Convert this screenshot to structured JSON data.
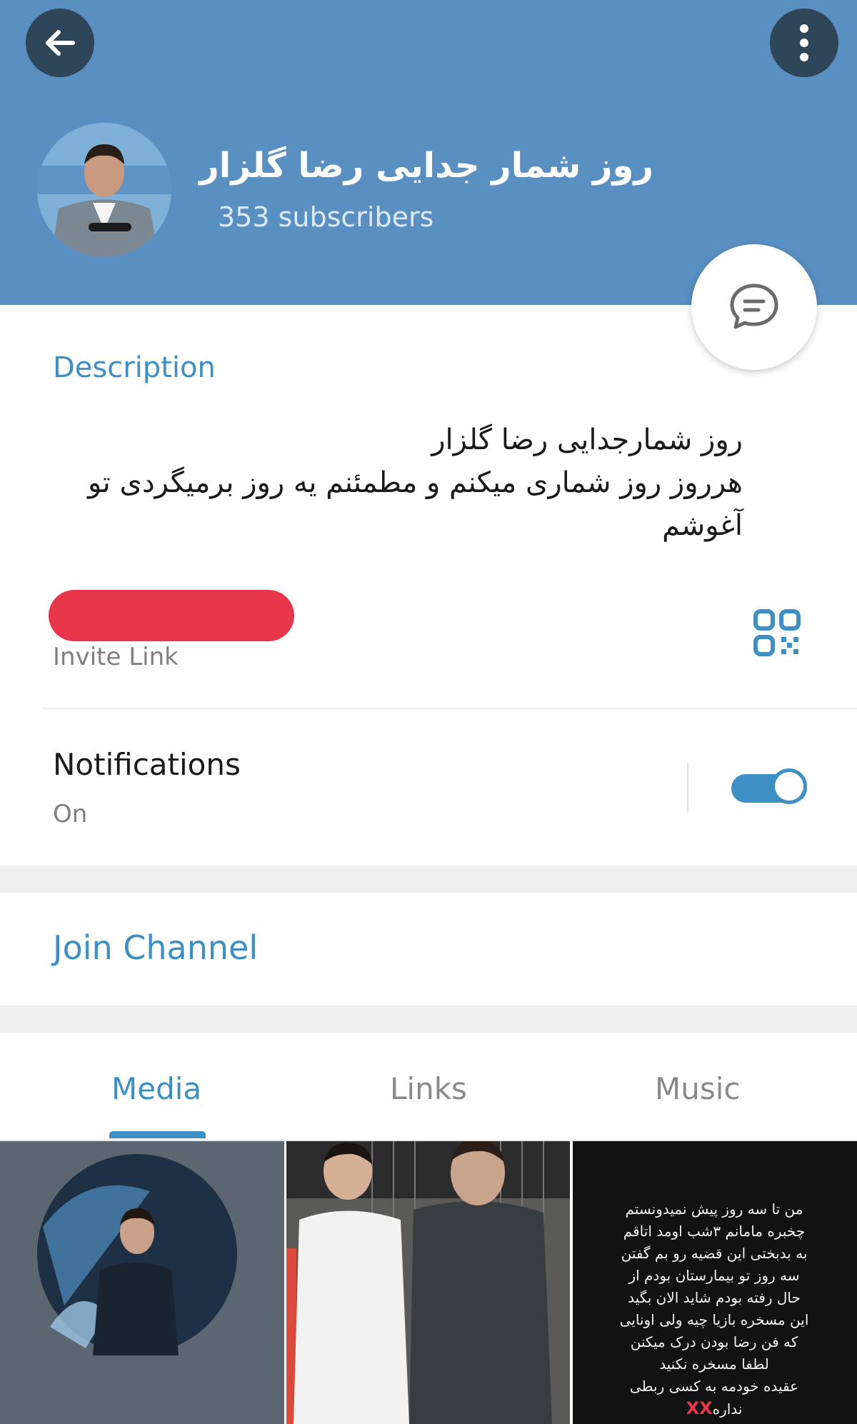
{
  "header": {
    "channel_name": "روز شمار جدایی رضا گلزار",
    "subscribers": "353 subscribers",
    "back_icon": "arrow-left-icon",
    "menu_icon": "more-vertical-icon",
    "fab_icon": "chat-bubble-icon",
    "colors": {
      "header_bg": "#5a8fc2",
      "button_bg": "#2f4558",
      "accent": "#3e8fc4"
    }
  },
  "info": {
    "description_label": "Description",
    "description_lines": [
      "روز شمارجدایی رضا گلزار",
      "هرروز روز شماری میکنم و مطمئنم یه روز برمیگردی تو",
      "آغوشم"
    ],
    "invite_link_label": "Invite Link",
    "qr_icon": "qr-code-icon"
  },
  "notifications": {
    "title": "Notifications",
    "state": "On",
    "enabled": true
  },
  "join": {
    "label": "Join Channel"
  },
  "tabs": [
    {
      "label": "Media",
      "active": true
    },
    {
      "label": "Links",
      "active": false
    },
    {
      "label": "Music",
      "active": false
    }
  ],
  "media": {
    "post_text_lines": [
      "من تا سه روز پیش نمیدونستم",
      "چخبره مامانم ۳شب اومد اتاقم",
      "به بدبختی این قضیه رو بم گفتن",
      "سه روز تو بیمارستان بودم از",
      "حال رفته بودم شاید الان بگید",
      "این مسخره بازیا چیه ولی اونایی",
      "که فن رضا بودن درک میکنن",
      "لطفا مسخره نکنید",
      "عقیده خودمه به کسی ربطی",
      "نداره"
    ],
    "post_text_tail": "XX"
  }
}
